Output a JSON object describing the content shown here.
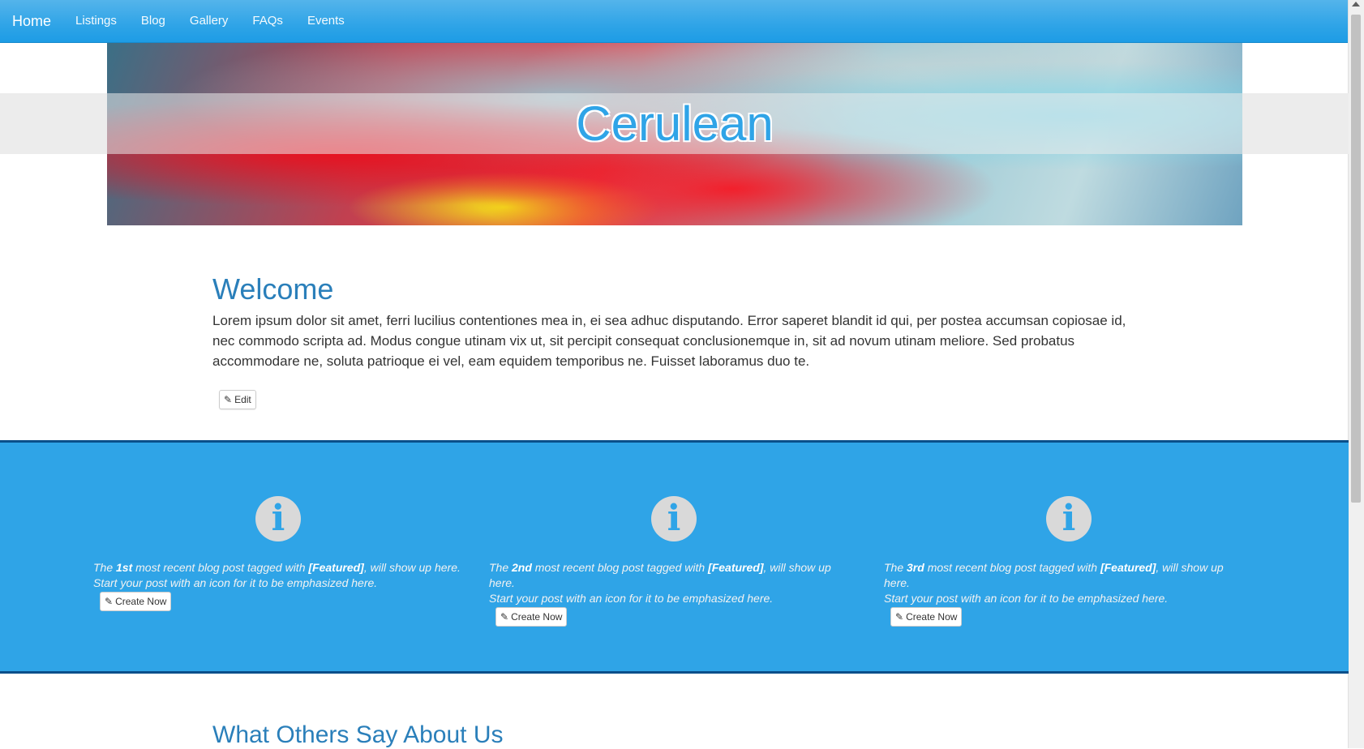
{
  "navbar": {
    "brand": "Home",
    "links": [
      "Listings",
      "Blog",
      "Gallery",
      "FAQs",
      "Events"
    ]
  },
  "hero": {
    "title": "Cerulean"
  },
  "welcome": {
    "title": "Welcome",
    "text": "Lorem ipsum dolor sit amet, ferri lucilius contentiones mea in, ei sea adhuc disputando. Error saperet blandit id qui, per postea accumsan copiosae id, nec commodo scripta ad. Modus congue utinam vix ut, sit percipit consequat conclusionemque in, sit ad novum utinam meliore. Sed probatus accommodare ne, soluta patrioque ei vel, eam equidem temporibus ne. Fuisset laboramus duo te.",
    "edit_label": "Edit"
  },
  "featured": {
    "items": [
      {
        "ordinal": "1st",
        "pre": "The ",
        "mid": " most recent blog post tagged with ",
        "tag": "[Featured]",
        "post": ", will show up here.",
        "line2": "Start your post with an icon for it to be emphasized here.",
        "button": "Create Now"
      },
      {
        "ordinal": "2nd",
        "pre": "The ",
        "mid": " most recent blog post tagged with ",
        "tag": "[Featured]",
        "post": ", will show up here.",
        "line2": "Start your post with an icon for it to be emphasized here.",
        "button": "Create Now"
      },
      {
        "ordinal": "3rd",
        "pre": "The ",
        "mid": " most recent blog post tagged with ",
        "tag": "[Featured]",
        "post": ", will show up here.",
        "line2": "Start your post with an icon for it to be emphasized here.",
        "button": "Create Now"
      }
    ],
    "icon": "info-icon"
  },
  "testimonials": {
    "title": "What Others Say About Us"
  },
  "colors": {
    "primary": "#2fa4e7",
    "heading": "#2a7fba",
    "band_border": "#0a4f8a"
  }
}
